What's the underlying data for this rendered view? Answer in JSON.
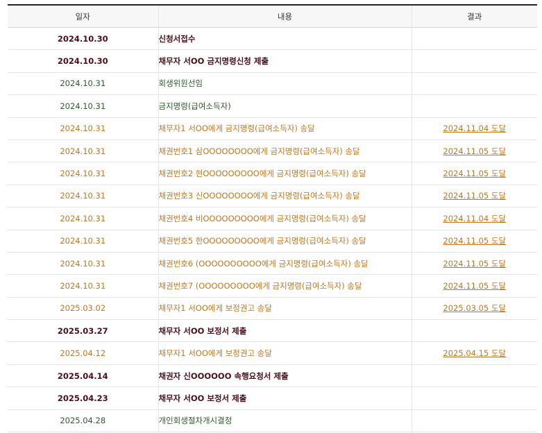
{
  "table": {
    "headers": [
      "일자",
      "내용",
      "결과"
    ],
    "rows": [
      {
        "date": "2024.10.30",
        "content": "신청서접수",
        "result": "",
        "kind": "filing"
      },
      {
        "date": "2024.10.30",
        "content": "채무자 서OO 금지명령신청 제출",
        "result": "",
        "kind": "filing"
      },
      {
        "date": "2024.10.31",
        "content": "회생위원선임",
        "result": "",
        "kind": "court"
      },
      {
        "date": "2024.10.31",
        "content": "금지명령(급여소득자)",
        "result": "",
        "kind": "court"
      },
      {
        "date": "2024.10.31",
        "content": "채무자1 서OO에게 금지명령(급여소득자) 송달",
        "result": "2024.11.04 도달",
        "kind": "service"
      },
      {
        "date": "2024.10.31",
        "content": "채권번호1 삼OOOOOOOO에게 금지명령(급여소득자) 송달",
        "result": "2024.11.05 도달",
        "kind": "service"
      },
      {
        "date": "2024.10.31",
        "content": "채권번호2 현OOOOOOOOO에게 금지명령(급여소득자) 송달",
        "result": "2024.11.05 도달",
        "kind": "service"
      },
      {
        "date": "2024.10.31",
        "content": "채권번호3 신OOOOOOOO에게 금지명령(급여소득자) 송달",
        "result": "2024.11.05 도달",
        "kind": "service"
      },
      {
        "date": "2024.10.31",
        "content": "채권번호4 비OOOOOOOOO에게 금지명령(급여소득자) 송달",
        "result": "2024.11.04 도달",
        "kind": "service"
      },
      {
        "date": "2024.10.31",
        "content": "채권번호5 한OOOOOOOOO에게 금지명령(급여소득자) 송달",
        "result": "2024.11.05 도달",
        "kind": "service"
      },
      {
        "date": "2024.10.31",
        "content": "채권번호6 (OOOOOOOOOO에게 금지명령(급여소득자) 송달",
        "result": "2024.11.05 도달",
        "kind": "service"
      },
      {
        "date": "2024.10.31",
        "content": "채권번호7 (OOOOOOOOO에게 금지명령(급여소득자) 송달",
        "result": "2024.11.05 도달",
        "kind": "service"
      },
      {
        "date": "2025.03.02",
        "content": "채무자1 서OO에게 보정권고 송달",
        "result": "2025.03.05 도달",
        "kind": "service"
      },
      {
        "date": "2025.03.27",
        "content": "채무자 서OO 보정서 제출",
        "result": "",
        "kind": "filing"
      },
      {
        "date": "2025.04.12",
        "content": "채무자1 서OO에게 보정권고 송달",
        "result": "2025.04.15 도달",
        "kind": "service"
      },
      {
        "date": "2025.04.14",
        "content": "채권자 신OOOOOO 속행요청서 제출",
        "result": "",
        "kind": "filing"
      },
      {
        "date": "2025.04.23",
        "content": "채무자 서OO 보정서 제출",
        "result": "",
        "kind": "filing"
      },
      {
        "date": "2025.04.28",
        "content": "개인회생절차개시결정",
        "result": "",
        "kind": "court"
      }
    ]
  },
  "colors": {
    "filing": "#4a0f1a",
    "court": "#2e5a2b",
    "service": "#c2761c",
    "header_border": "#222222"
  }
}
